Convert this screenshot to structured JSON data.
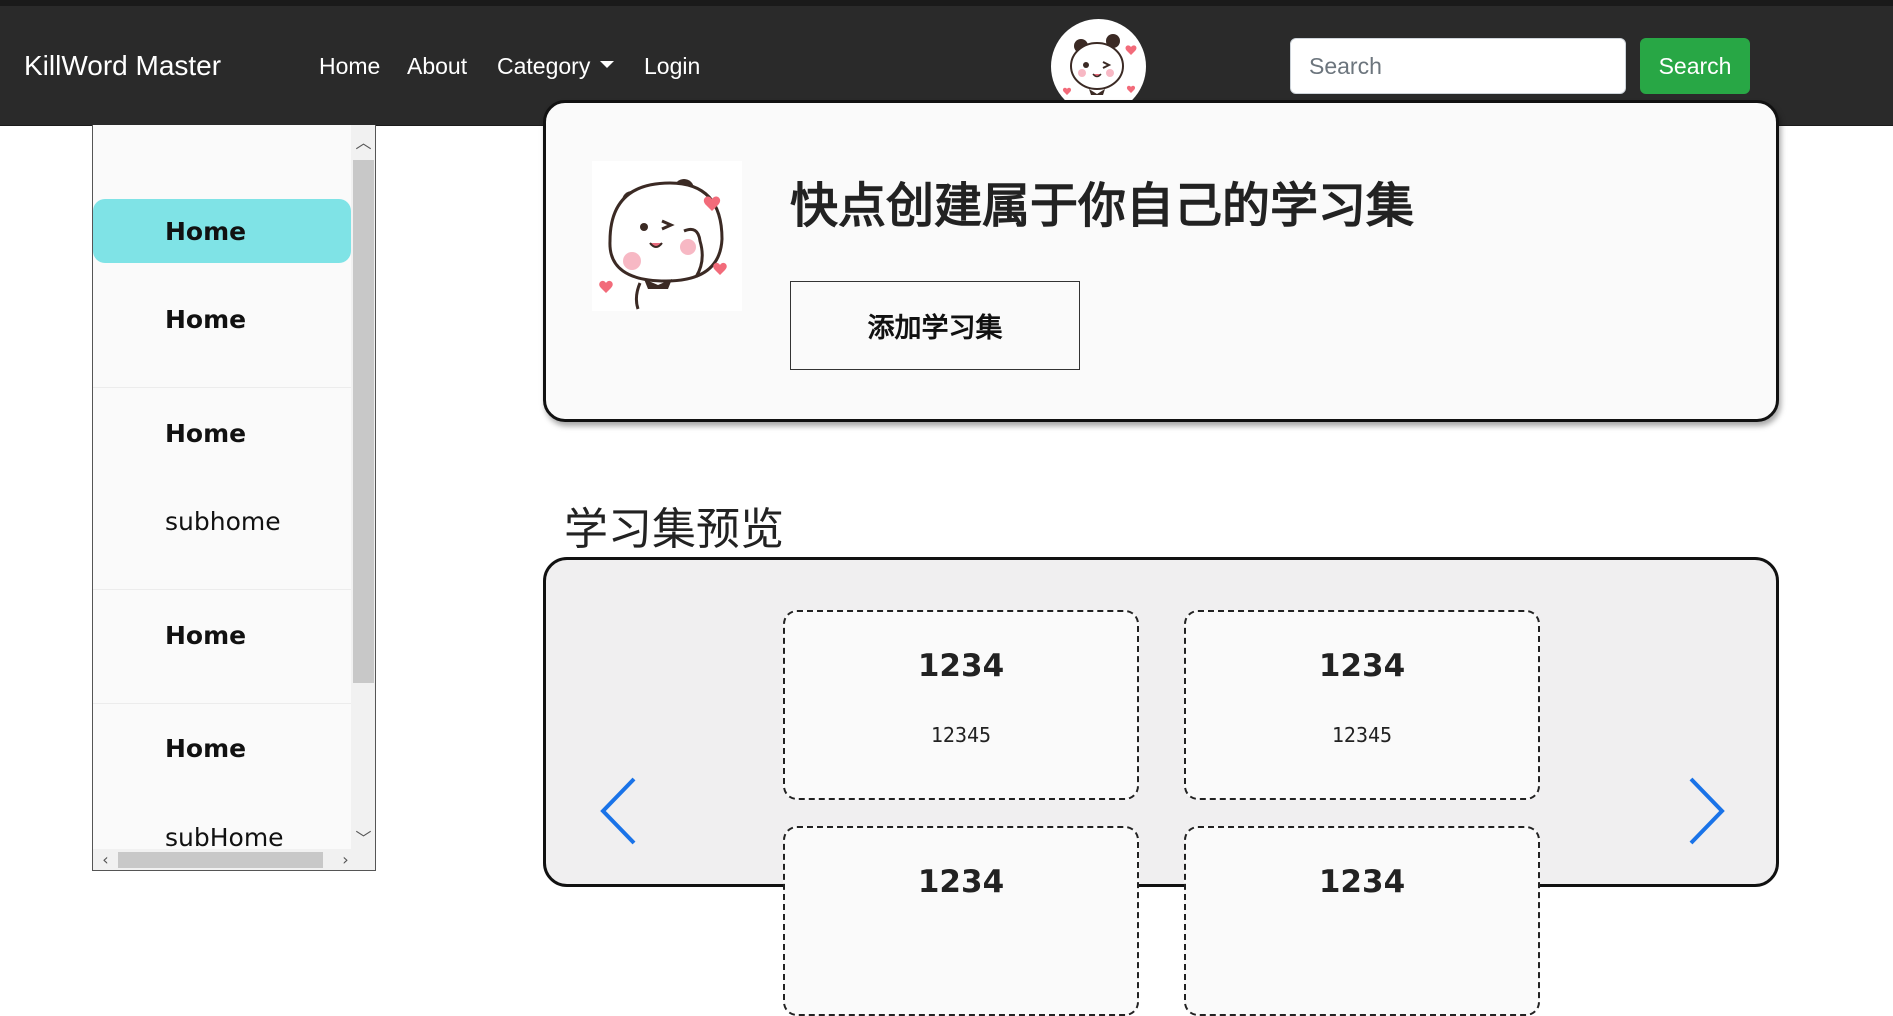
{
  "navbar": {
    "brand": "KillWord Master",
    "links": [
      "Home",
      "About",
      "Category",
      "Login"
    ],
    "search": {
      "placeholder": "Search",
      "button": "Search"
    }
  },
  "sidebar": {
    "items": [
      {
        "label": "Home",
        "active": true
      },
      {
        "label": "Home"
      },
      {
        "label": "Home"
      },
      {
        "label": "subhome"
      },
      {
        "label": "Home"
      },
      {
        "label": "Home"
      },
      {
        "label": "subHome"
      }
    ]
  },
  "hero": {
    "title": "快点创建属于你自己的学习集",
    "button": "添加学习集"
  },
  "preview": {
    "title": "学习集预览",
    "cards": [
      {
        "title": "1234",
        "subtitle": "12345"
      },
      {
        "title": "1234",
        "subtitle": "12345"
      },
      {
        "title": "1234",
        "subtitle": ""
      },
      {
        "title": "1234",
        "subtitle": ""
      }
    ]
  },
  "colors": {
    "navbar": "#2a2a2a",
    "search_button": "#28a745",
    "sidebar_active": "#7fe3e6",
    "carousel_arrow": "#1a73e8"
  },
  "icons": {
    "prev": "chevron-left-icon",
    "next": "chevron-right-icon",
    "dropdown": "caret-down-icon",
    "avatar": "panda-avatar-icon"
  }
}
